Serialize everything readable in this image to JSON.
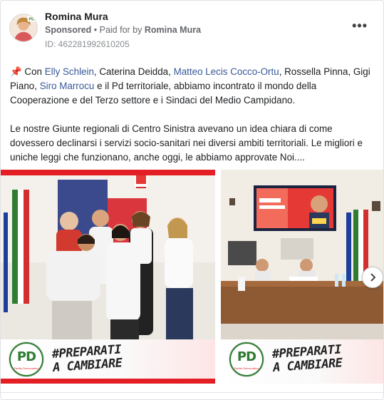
{
  "post": {
    "author": "Romina Mura",
    "sponsored": "Sponsored",
    "paid_for_prefix": " • Paid for by ",
    "paid_for_name": "Romina Mura",
    "ad_id": "ID: 462281992610205",
    "more_icon": "more-horizontal-icon"
  },
  "text": {
    "pin_icon": "📌",
    "p1_a": " Con ",
    "p1_link1": "Elly Schlein",
    "p1_b": ", Caterina Deidda, ",
    "p1_link2": "Matteo Lecis Cocco-Ortu",
    "p1_c": ", Rossella Pinna, Gigi Piano, ",
    "p1_link3": "Siro Marrocu",
    "p1_d": " e il Pd territoriale, abbiamo incontrato il mondo della Cooperazione e del Terzo settore e i Sindaci del Medio Campidano.",
    "p2": "Le nostre Giunte regionali di Centro Sinistra avevano un idea chiara di come dovessero declinarsi i servizi socio-sanitari nei diversi ambiti territoriali. Le migliori e uniche leggi che funzionano, anche oggi, le abbiamo approvate Noi...."
  },
  "carousel": {
    "slides": [
      {
        "slogan_line1": "#PREPARATI",
        "slogan_line2": "A CAMBIARE",
        "logo_text": "PD",
        "logo_sub": "Partito Democratico"
      },
      {
        "slogan_line1": "#PREPARATI",
        "slogan_line2": "A CAMBIARE",
        "logo_text": "PD",
        "logo_sub": "Partito Democratico"
      }
    ],
    "next_icon": "chevron-right-icon"
  },
  "colors": {
    "brand_red": "#e31e24",
    "brand_green": "#2e7d32",
    "link": "#385898"
  }
}
